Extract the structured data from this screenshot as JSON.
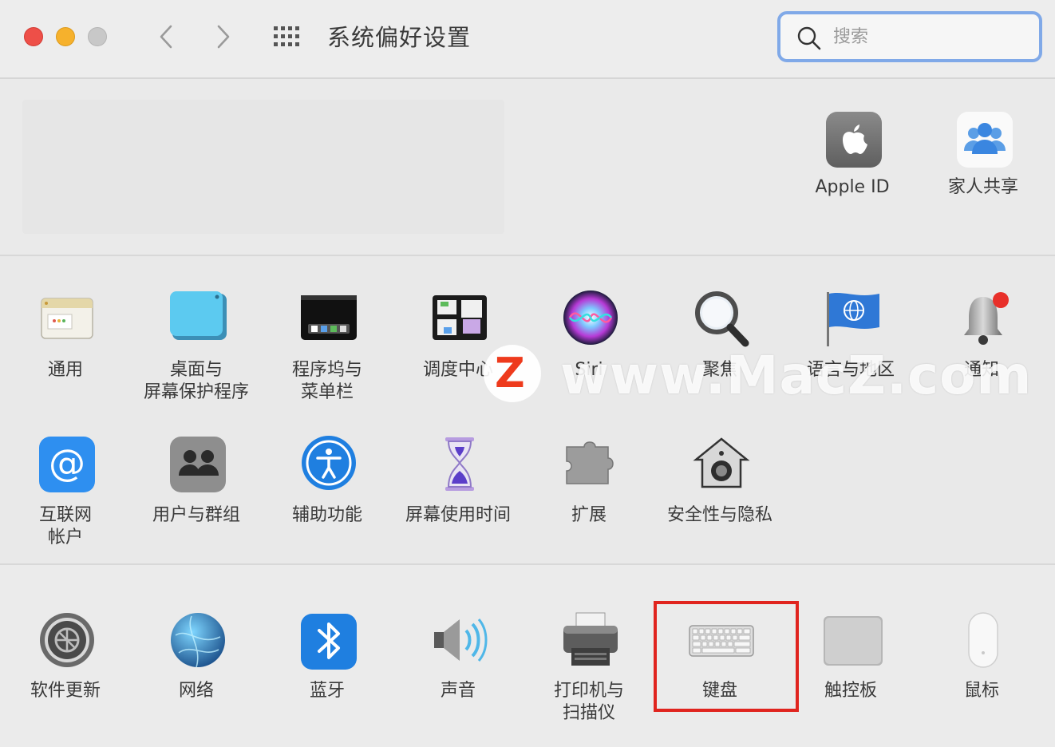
{
  "window": {
    "title": "系统偏好设置",
    "search_placeholder": "搜索"
  },
  "account": {
    "items": [
      {
        "label": "Apple ID",
        "icon": "apple-id-icon"
      },
      {
        "label": "家人共享",
        "icon": "family-sharing-icon"
      }
    ]
  },
  "row1": [
    {
      "label": "通用",
      "icon": "general-icon"
    },
    {
      "label": "桌面与\n屏幕保护程序",
      "icon": "desktop-screensaver-icon"
    },
    {
      "label": "程序坞与\n菜单栏",
      "icon": "dock-menubar-icon"
    },
    {
      "label": "调度中心",
      "icon": "mission-control-icon"
    },
    {
      "label": "Siri",
      "icon": "siri-icon"
    },
    {
      "label": "聚焦",
      "icon": "spotlight-icon"
    },
    {
      "label": "语言与地区",
      "icon": "language-region-icon"
    },
    {
      "label": "通知",
      "icon": "notifications-icon"
    }
  ],
  "row2": [
    {
      "label": "互联网\n帐户",
      "icon": "internet-accounts-icon"
    },
    {
      "label": "用户与群组",
      "icon": "users-groups-icon"
    },
    {
      "label": "辅助功能",
      "icon": "accessibility-icon"
    },
    {
      "label": "屏幕使用时间",
      "icon": "screen-time-icon"
    },
    {
      "label": "扩展",
      "icon": "extensions-icon"
    },
    {
      "label": "安全性与隐私",
      "icon": "security-privacy-icon"
    }
  ],
  "row3": [
    {
      "label": "软件更新",
      "icon": "software-update-icon"
    },
    {
      "label": "网络",
      "icon": "network-icon"
    },
    {
      "label": "蓝牙",
      "icon": "bluetooth-icon"
    },
    {
      "label": "声音",
      "icon": "sound-icon"
    },
    {
      "label": "打印机与\n扫描仪",
      "icon": "printers-scanners-icon"
    },
    {
      "label": "键盘",
      "icon": "keyboard-icon"
    },
    {
      "label": "触控板",
      "icon": "trackpad-icon"
    },
    {
      "label": "鼠标",
      "icon": "mouse-icon"
    }
  ],
  "watermark": {
    "badge": "Z",
    "text": "www.MacZ.com"
  },
  "colors": {
    "highlight": "#e0241e",
    "search_focus": "#80a9e8"
  }
}
